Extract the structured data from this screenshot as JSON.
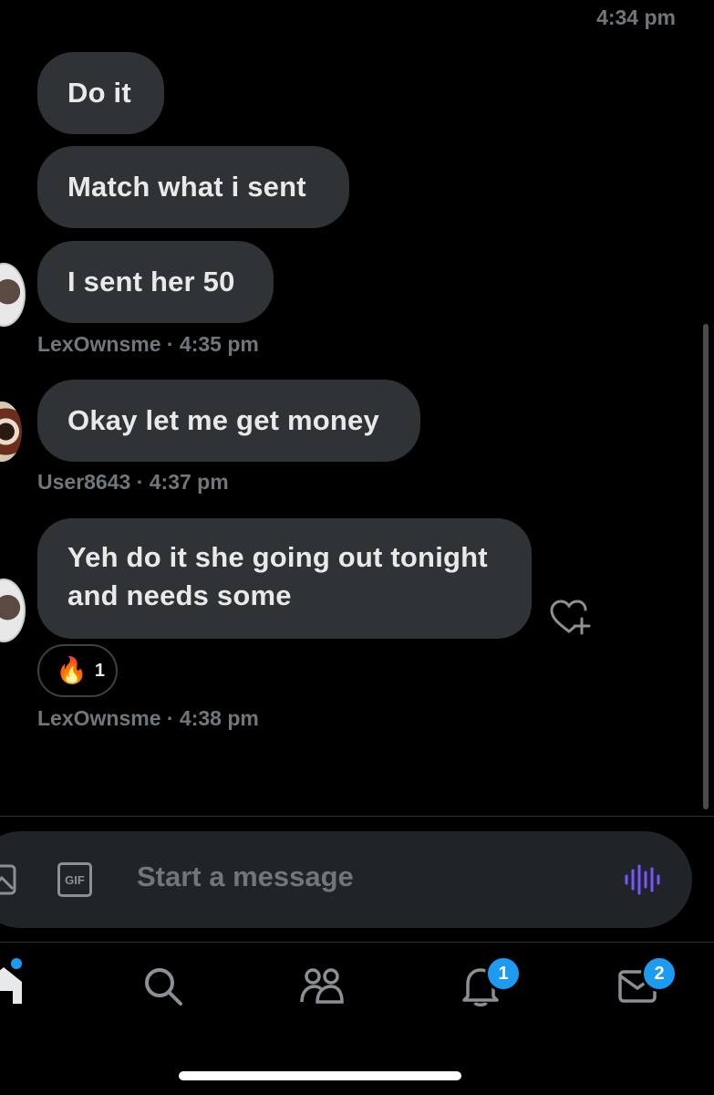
{
  "top_timestamp": "4:34 pm",
  "messages": [
    {
      "text": "Do it"
    },
    {
      "text": "Match what i sent"
    },
    {
      "text": "I sent her 50"
    },
    {
      "text": "Okay let me get money"
    },
    {
      "text": "Yeh do it she going out tonight and needs some"
    }
  ],
  "meta": [
    {
      "text": "LexOwnsme · 4:35 pm"
    },
    {
      "text": "User8643 · 4:37 pm"
    },
    {
      "text": "LexOwnsme · 4:38 pm"
    }
  ],
  "reaction": {
    "emoji": "🔥",
    "count": "1"
  },
  "composer": {
    "placeholder": "Start a message",
    "gif_label": "GIF"
  },
  "nav": {
    "notifications_badge": "1",
    "messages_badge": "2"
  },
  "icons": {
    "image": "image-icon",
    "gif": "gif-icon",
    "voice": "voice-wave-icon",
    "home": "home-icon",
    "search": "search-icon",
    "communities": "communities-icon",
    "notifications": "bell-icon",
    "messages": "mail-icon",
    "add_reaction": "heart-plus-icon"
  },
  "colors": {
    "accent": "#1d9bf0",
    "voice": "#7856ff",
    "bubble": "#2f3336"
  }
}
